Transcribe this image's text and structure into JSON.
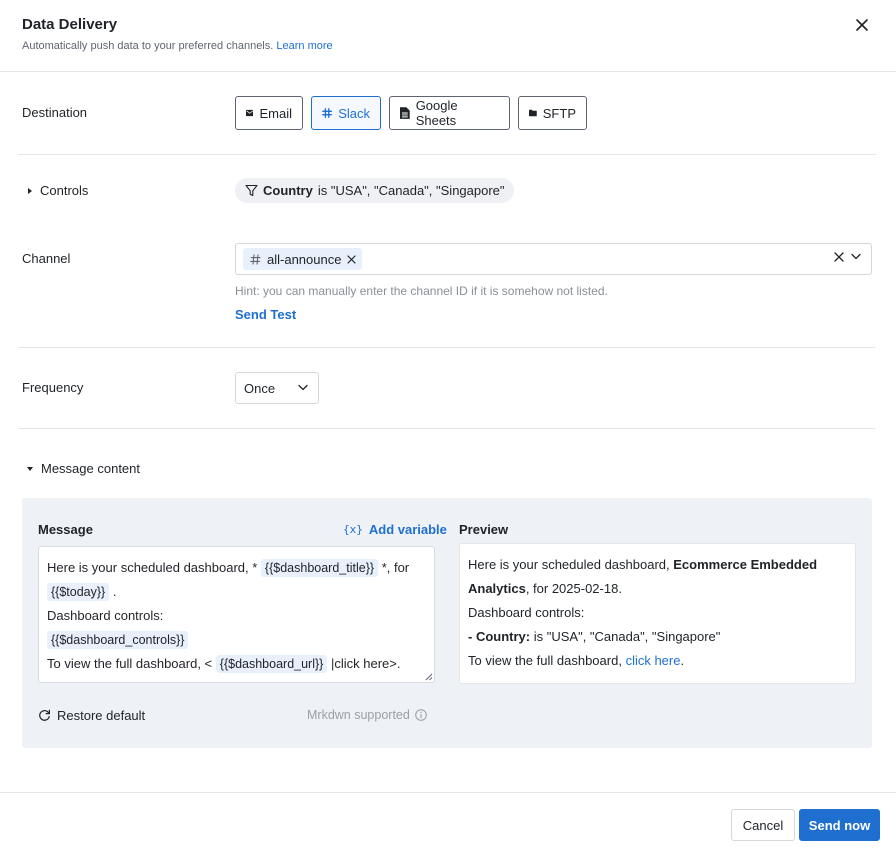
{
  "dialog": {
    "title": "Data Delivery",
    "subtitle": "Automatically push data to your preferred channels.",
    "learn_more": "Learn more"
  },
  "destination": {
    "label": "Destination",
    "options": [
      "Email",
      "Slack",
      "Google Sheets",
      "SFTP"
    ],
    "selected": "Slack"
  },
  "controls": {
    "label": "Controls",
    "filter_field": "Country",
    "filter_rest": "is \"USA\", \"Canada\", \"Singapore\""
  },
  "channel": {
    "label": "Channel",
    "selected_tag": "all-announce",
    "hint": "Hint: you can manually enter the channel ID if it is somehow not listed.",
    "send_test": "Send Test"
  },
  "frequency": {
    "label": "Frequency",
    "value": "Once"
  },
  "message_content": {
    "label": "Message content",
    "message_label": "Message",
    "add_variable": "Add variable",
    "add_variable_icon": "{x}",
    "preview_label": "Preview",
    "editor": {
      "l1a": "Here is your scheduled dashboard, *",
      "v_title": "{{$dashboard_title}}",
      "l1b": "*, for",
      "v_today": "{{$today}}",
      "l2b": ".",
      "l3": "Dashboard controls:",
      "v_controls": "{{$dashboard_controls}}",
      "l5a": "To view the full dashboard, <",
      "v_url": "{{$dashboard_url}}",
      "l5b": "|click here>."
    },
    "preview": {
      "p1": "Here is your scheduled dashboard,",
      "p1_bold": "Ecommerce Embedded Analytics",
      "p2": ", for 2025-02-18.",
      "p3": "Dashboard controls:",
      "p4_bold": "- Country:",
      "p4": "is \"USA\", \"Canada\", \"Singapore\"",
      "p5": "To view the full dashboard,",
      "p5_link": "click here",
      "p5_end": "."
    },
    "restore_default": "Restore default",
    "mrkdwn": "Mrkdwn supported"
  },
  "footer": {
    "cancel": "Cancel",
    "send_now": "Send now"
  },
  "colors": {
    "accent": "#1f6fd1",
    "panel_bg": "#eef1f5",
    "tag_bg": "#e8f0fc"
  }
}
